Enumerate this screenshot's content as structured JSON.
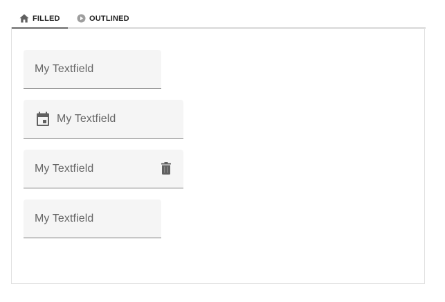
{
  "tabs": [
    {
      "label": "FILLED",
      "icon": "home-icon",
      "active": true
    },
    {
      "label": "OUTLINED",
      "icon": "play-circle-icon",
      "active": false
    }
  ],
  "fields": [
    {
      "label": "My Textfield"
    },
    {
      "label": "My Textfield",
      "leading_icon": "calendar-icon"
    },
    {
      "label": "My Textfield",
      "trailing_icon": "trash-icon"
    },
    {
      "label": "My Textfield"
    }
  ],
  "colors": {
    "field_bg": "#f5f5f5",
    "label": "#666666",
    "icon": "#616161",
    "underline": "#7a7a7a",
    "tab_indicator": "#8a8a8a",
    "border": "#e0e0e0"
  }
}
